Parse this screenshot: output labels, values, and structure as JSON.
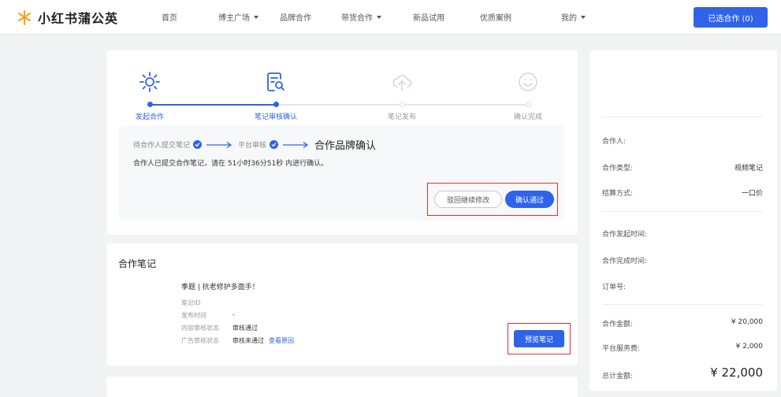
{
  "header": {
    "brand": "小红书蒲公英",
    "nav": [
      {
        "label": "首页"
      },
      {
        "label": "博主广场"
      },
      {
        "label": "品牌合作"
      },
      {
        "label": "带货合作"
      },
      {
        "label": "新品试用"
      },
      {
        "label": "优质案例"
      },
      {
        "label": "我的"
      }
    ],
    "cta_label": "已选合作 (0)"
  },
  "steps": [
    {
      "label": "发起合作",
      "icon": "sparkle-icon",
      "state": "done"
    },
    {
      "label": "笔记审核确认",
      "icon": "doc-search-icon",
      "state": "current"
    },
    {
      "label": "笔记发布",
      "icon": "cloud-upload-icon",
      "state": "pending"
    },
    {
      "label": "确认完成",
      "icon": "smile-icon",
      "state": "pending"
    }
  ],
  "confirm": {
    "flow_1": "待合作人提交笔记",
    "flow_2": "平台审核",
    "flow_3": "合作品牌确认",
    "notice": "合作人已提交合作笔记，请在 51小时36分51秒 内进行确认。",
    "reject_label": "驳回继续修改",
    "approve_label": "确认通过"
  },
  "note": {
    "section_title": "合作笔记",
    "title": "季题 | 抗老修护多面手！",
    "meta": [
      {
        "label": "笔记ID",
        "value": ""
      },
      {
        "label": "发布时间",
        "value": "-"
      },
      {
        "label": "内容审核状态",
        "value": "审核通过"
      },
      {
        "label": "广告审核状态",
        "value": "审核未通过"
      }
    ],
    "view_reason": "查看原因",
    "preview_label": "预览笔记"
  },
  "side": {
    "partner_label": "合作人:",
    "type_label": "合作类型:",
    "type_value": "视频笔记",
    "payment_label": "结算方式:",
    "payment_value": "一口价",
    "start_time_label": "合作发起时间:",
    "complete_time_label": "合作完成时间:",
    "order_label": "订单号:",
    "amount_label": "合作金额:",
    "amount_value": "¥ 20,000",
    "fee_label": "平台服务费:",
    "fee_value": "¥ 2,000",
    "total_label": "总计金额:",
    "total_value": "¥ 22,000"
  },
  "colors": {
    "accent": "#2f63e8",
    "highlight_border": "#e23030",
    "inactive": "#d8dce3"
  }
}
